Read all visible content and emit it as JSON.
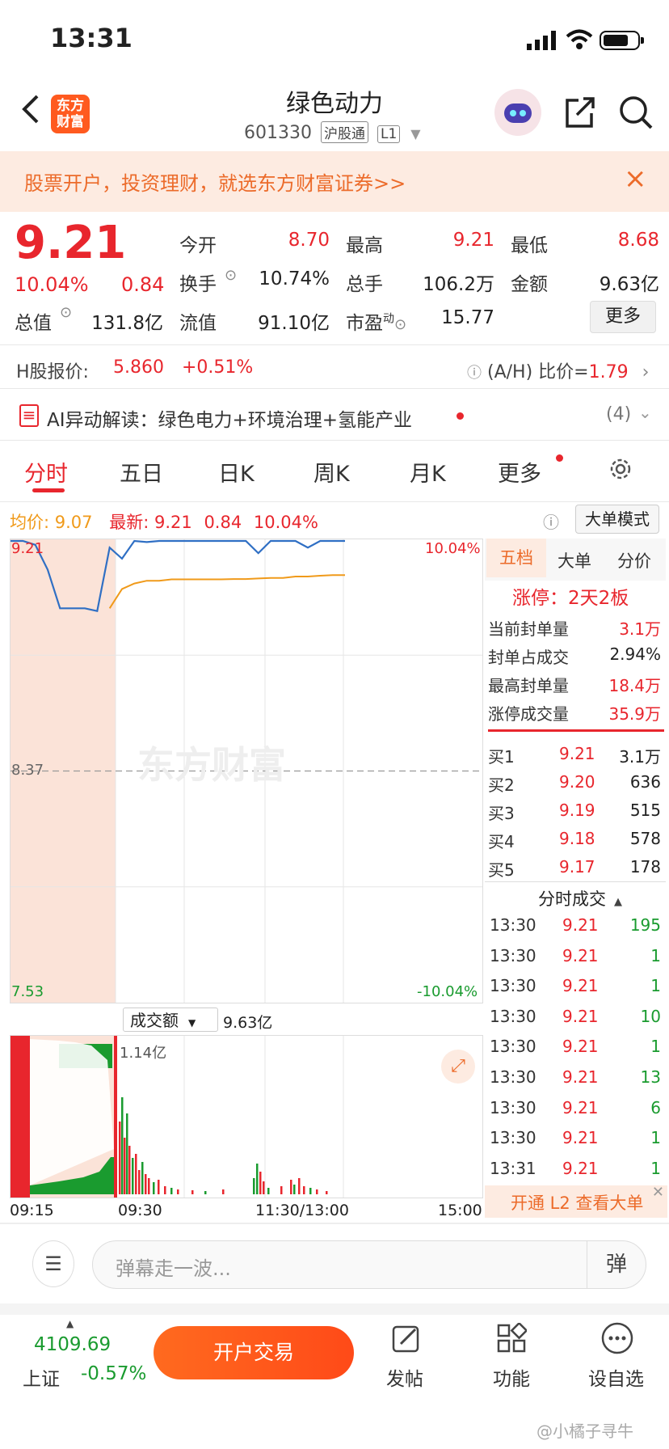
{
  "status": {
    "time": "13:31"
  },
  "header": {
    "title": "绿色动力",
    "code": "601330",
    "tag1": "沪股通",
    "tag2": "L1",
    "logo_line1": "东方",
    "logo_line2": "财富"
  },
  "banner": {
    "text": "股票开户，投资理财，就选东方财富证券>>",
    "close": "×"
  },
  "quote": {
    "price": "9.21",
    "change_pct": "10.04%",
    "change": "0.84",
    "open_label": "今开",
    "open": "8.70",
    "high_label": "最高",
    "high": "9.21",
    "low_label": "最低",
    "low": "8.68",
    "turnover_label": "换手",
    "turnover": "10.74%",
    "volume_label": "总手",
    "volume": "106.2万",
    "amount_label": "金额",
    "amount": "9.63亿",
    "mktcap_label": "总值",
    "mktcap": "131.8亿",
    "float_label": "流值",
    "float": "91.10亿",
    "pe_label": "市盈",
    "pe_sup": "动",
    "pe": "15.77",
    "more": "更多"
  },
  "hshare": {
    "label": "H股报价:",
    "price": "5.860",
    "pct": "+0.51%",
    "ah_label": "(A/H) 比价=",
    "ah_value": "1.79"
  },
  "ai": {
    "text": "AI异动解读：绿色电力+环境治理+氢能产业",
    "count": "(4)"
  },
  "tabs": [
    "分时",
    "五日",
    "日K",
    "周K",
    "月K",
    "更多"
  ],
  "summary": {
    "avg_label": "均价:",
    "avg": "9.07",
    "latest_label": "最新:",
    "latest": "9.21",
    "chg": "0.84",
    "pct": "10.04%",
    "mode_btn": "大单模式"
  },
  "chart_data": {
    "type": "line",
    "title": "",
    "y_top": "9.21",
    "y_mid": "8.37",
    "y_bot": "7.53",
    "pct_top": "10.04%",
    "pct_bot": "-10.04%",
    "x_labels": [
      "09:15",
      "09:30",
      "11:30/13:00",
      "15:00"
    ],
    "watermark": "东方财富",
    "ylim": [
      7.53,
      9.21
    ],
    "price_series": [
      9.21,
      9.21,
      9.19,
      9.1,
      8.96,
      8.96,
      8.96,
      8.95,
      9.18,
      9.14,
      9.21,
      9.2,
      9.21,
      9.21,
      9.21,
      9.21,
      9.21,
      9.21,
      9.21,
      9.21,
      9.16,
      9.21,
      9.21,
      9.21,
      9.18,
      9.21,
      9.21,
      9.21
    ],
    "avg_series": [
      null,
      null,
      null,
      null,
      null,
      null,
      null,
      null,
      8.96,
      9.03,
      9.05,
      9.06,
      9.06,
      9.065,
      9.065,
      9.065,
      9.065,
      9.065,
      9.066,
      9.066,
      9.068,
      9.07,
      9.07,
      9.075,
      9.075,
      9.078,
      9.08,
      9.08
    ]
  },
  "volume": {
    "selector": "成交额",
    "total": "9.63亿",
    "peak": "1.14亿"
  },
  "panel": {
    "tabs": [
      "五档",
      "大单",
      "分价"
    ],
    "limit": "涨停：2天2板",
    "stats": [
      {
        "label": "当前封单量",
        "value": "3.1万"
      },
      {
        "label": "封单占成交",
        "value": "2.94%"
      },
      {
        "label": "最高封单量",
        "value": "18.4万"
      },
      {
        "label": "涨停成交量",
        "value": "35.9万"
      }
    ],
    "bids": [
      {
        "label": "买1",
        "price": "9.21",
        "vol": "3.1万"
      },
      {
        "label": "买2",
        "price": "9.20",
        "vol": "636"
      },
      {
        "label": "买3",
        "price": "9.19",
        "vol": "515"
      },
      {
        "label": "买4",
        "price": "9.18",
        "vol": "578"
      },
      {
        "label": "买5",
        "price": "9.17",
        "vol": "178"
      }
    ],
    "ticks_title": "分时成交",
    "ticks": [
      {
        "t": "13:30",
        "p": "9.21",
        "v": "195"
      },
      {
        "t": "13:30",
        "p": "9.21",
        "v": "1"
      },
      {
        "t": "13:30",
        "p": "9.21",
        "v": "1"
      },
      {
        "t": "13:30",
        "p": "9.21",
        "v": "10"
      },
      {
        "t": "13:30",
        "p": "9.21",
        "v": "1"
      },
      {
        "t": "13:30",
        "p": "9.21",
        "v": "13"
      },
      {
        "t": "13:30",
        "p": "9.21",
        "v": "6"
      },
      {
        "t": "13:30",
        "p": "9.21",
        "v": "1"
      },
      {
        "t": "13:31",
        "p": "9.21",
        "v": "1"
      }
    ],
    "l2": "开通 L2 查看大单"
  },
  "comment": {
    "placeholder": "弹幕走一波...",
    "send": "弹"
  },
  "bottom": {
    "index_value": "4109.69",
    "index_name": "上证",
    "index_pct": "-0.57%",
    "trade": "开户交易",
    "post": "发帖",
    "func": "功能",
    "fav": "设自选",
    "watermark": "@小橘子寻牛"
  },
  "colors": {
    "up": "#e8262d",
    "down": "#1a9b2f",
    "price_line": "#2f6fc4",
    "avg_line": "#f09a1a",
    "accent": "#ff5a1f"
  }
}
